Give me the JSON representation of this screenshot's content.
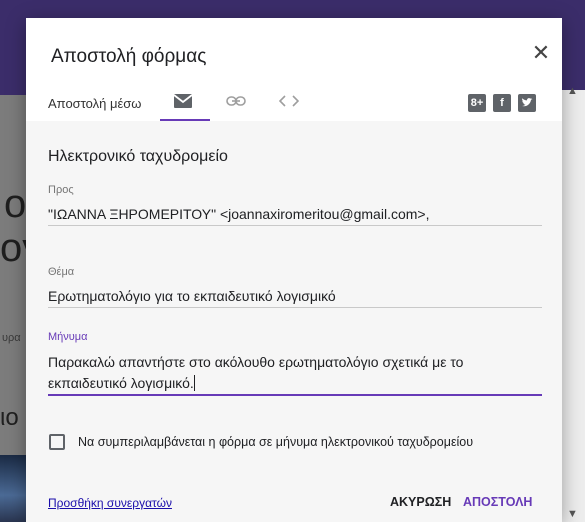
{
  "dialog": {
    "title": "Αποστολή φόρμας",
    "close_icon": "close-icon",
    "send_via_label": "Αποστολή μέσω",
    "tabs": [
      {
        "name": "email",
        "icon": "envelope-icon"
      },
      {
        "name": "link",
        "icon": "link-icon"
      },
      {
        "name": "embed",
        "icon": "code-icon"
      }
    ],
    "social": [
      {
        "label": "8+",
        "icon": "google-plus-icon"
      },
      {
        "label": "f",
        "icon": "facebook-icon"
      },
      {
        "label": "t",
        "icon": "twitter-icon"
      }
    ],
    "section_title": "Ηλεκτρονικό ταχυδρομείο",
    "to": {
      "label": "Προς",
      "value": "\"ΙΩΑΝΝΑ ΞΗΡΟΜΕΡΙΤΟΥ\" <joannaxiromeritou@gmail.com>,"
    },
    "subject": {
      "label": "Θέμα",
      "value": "Ερωτηματολόγιο για το εκπαιδευτικό λογισμικό"
    },
    "message": {
      "label": "Μήνυμα",
      "line1": "Παρακαλώ απαντήστε στο ακόλουθο ερωτηματολόγιο σχετικά με το",
      "line2": "εκπαιδευτικό λογισμικό."
    },
    "include_form_label": "Να συμπεριλαμβάνεται η φόρμα σε μήνυμα ηλεκτρονικού ταχυδρομείου",
    "add_collaborators": "Προσθήκη συνεργατών",
    "cancel": "ΑΚΥΡΩΣΗ",
    "send": "ΑΠΟΣΤΟΛΗ",
    "accent_color": "#673ab7"
  },
  "background": {
    "letters": [
      "ο",
      "ογ",
      "ιο"
    ],
    "partial": "υρα"
  }
}
